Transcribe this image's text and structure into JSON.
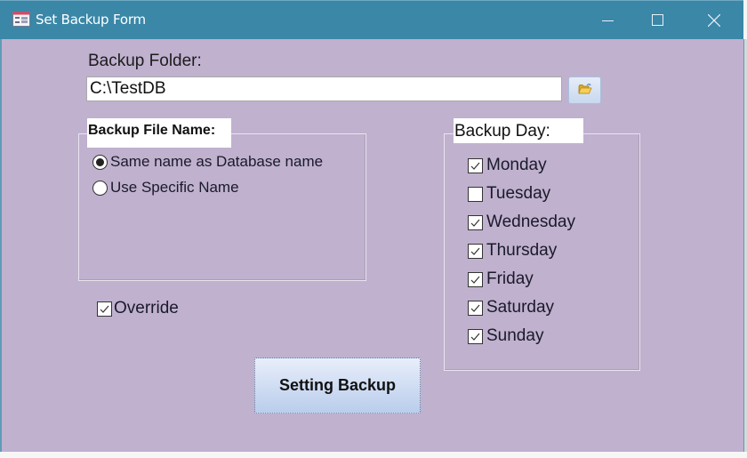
{
  "window": {
    "title": "Set Backup Form",
    "app_icon": "form-icon",
    "controls": {
      "minimize_icon": "minimize-icon",
      "maximize_icon": "maximize-icon",
      "close_icon": "close-icon"
    }
  },
  "colors": {
    "titlebar": "#3a87a8",
    "form_background": "#c0b1cf",
    "button_gradient_top": "#e8eefa",
    "button_gradient_bottom": "#b9cdec"
  },
  "backup_folder": {
    "label": "Backup Folder:",
    "value": "C:\\TestDB",
    "browse_icon": "folder-open-icon"
  },
  "backup_file_name": {
    "caption": "Backup File Name:",
    "options": [
      {
        "label": "Same name as Database name",
        "selected": true
      },
      {
        "label": "Use Specific Name",
        "selected": false
      }
    ]
  },
  "override": {
    "label": "Override",
    "checked": true
  },
  "backup_day": {
    "caption": "Backup Day:",
    "days": [
      {
        "label": "Monday",
        "checked": true
      },
      {
        "label": "Tuesday",
        "checked": false
      },
      {
        "label": "Wednesday",
        "checked": true
      },
      {
        "label": "Thursday",
        "checked": true
      },
      {
        "label": "Friday",
        "checked": true
      },
      {
        "label": "Saturday",
        "checked": true
      },
      {
        "label": "Sunday",
        "checked": true
      }
    ]
  },
  "actions": {
    "setting_backup_label": "Setting Backup"
  }
}
